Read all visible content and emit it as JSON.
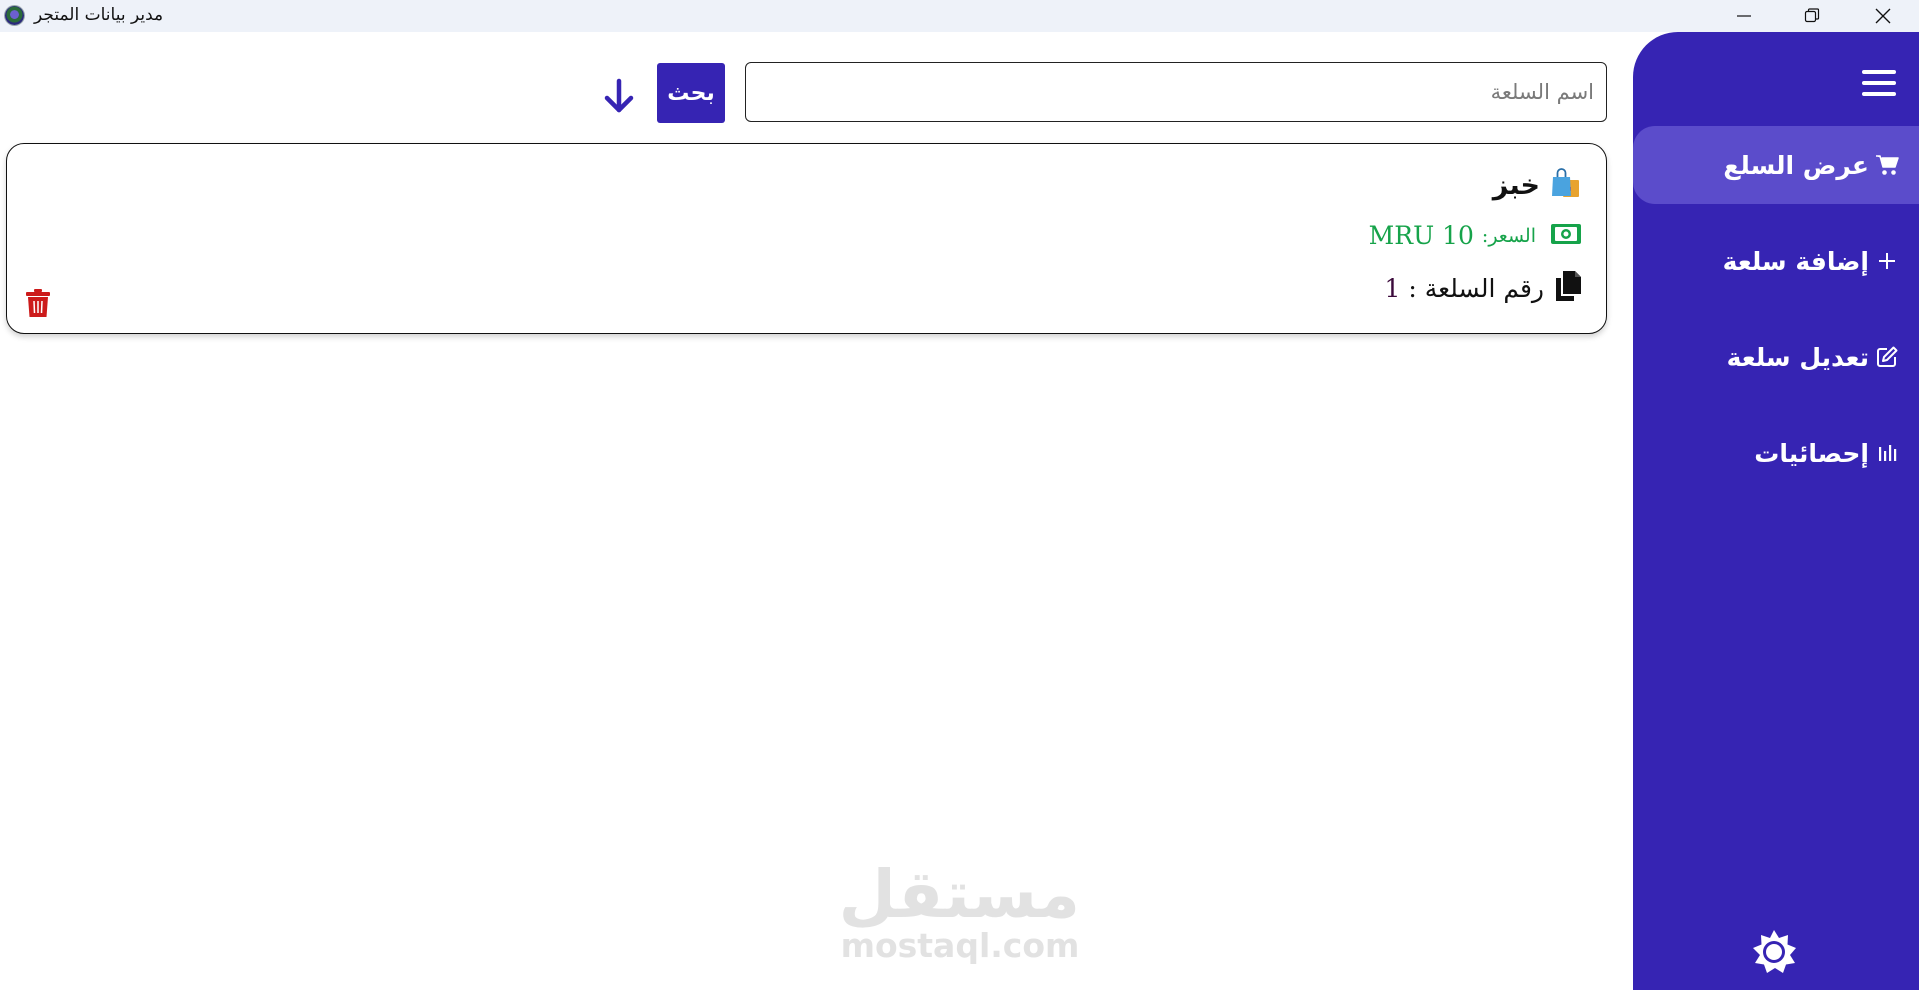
{
  "window": {
    "title": "مدير بيانات المتجر",
    "controls": [
      "minimize",
      "maximize",
      "close"
    ]
  },
  "sidebar": {
    "menu_icon": "hamburger-icon",
    "items": [
      {
        "label": "عرض السلع",
        "icon": "cart-icon",
        "active": true
      },
      {
        "label": "إضافة سلعة",
        "icon": "plus-icon",
        "active": false
      },
      {
        "label": "تعديل سلعة",
        "icon": "edit-icon",
        "active": false
      },
      {
        "label": "إحصائيات",
        "icon": "stats-icon",
        "active": false
      }
    ],
    "theme_icon": "sun-icon"
  },
  "search": {
    "placeholder": "اسم السلعة",
    "value": "",
    "button_label": "بحث",
    "sort_icon": "arrow-down-icon"
  },
  "products": [
    {
      "name": "خبز",
      "icon": "shopping-bags-icon",
      "price_label": "السعر:",
      "price": "MRU 10",
      "id_label": "رقم السلعة",
      "id_separator": ":",
      "id": "1"
    }
  ],
  "watermark": {
    "arabic": "مستقل",
    "latin": "mostaql.com"
  },
  "colors": {
    "sidebar": "#3624b3",
    "sidebar_active": "#5b4ccb",
    "price": "#16a34a",
    "delete": "#cc1b1b"
  }
}
